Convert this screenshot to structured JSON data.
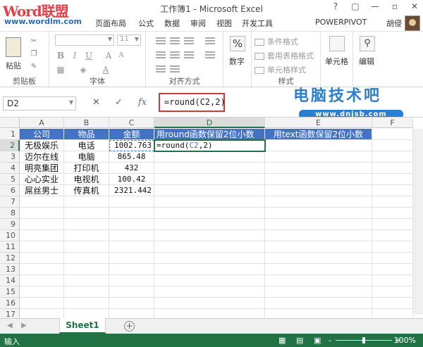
{
  "window": {
    "title": "工作簿1 - Microsoft Excel",
    "watermark_logo": "Word联盟",
    "watermark_url": "www.wordlm.com",
    "buttons": [
      "?",
      "▢",
      "—",
      "▫",
      "✕"
    ]
  },
  "ribbon_tabs": [
    "页面布局",
    "公式",
    "数据",
    "审阅",
    "视图",
    "开发工具",
    "POWERPIVOT"
  ],
  "user": "胡侵",
  "ribbon": {
    "clipboard": {
      "paste_label": "粘贴",
      "group_label": "剪贴板"
    },
    "font": {
      "font_name": "",
      "font_size": "11",
      "group_label": "字体"
    },
    "alignment": {
      "group_label": "对齐方式"
    },
    "number": {
      "icon": "%",
      "label": "数字"
    },
    "styles": {
      "items": [
        "条件格式",
        "套用表格格式",
        "单元格样式"
      ],
      "group_label": "样式"
    },
    "cells": {
      "label": "单元格"
    },
    "editing": {
      "label": "编辑"
    }
  },
  "formula_bar": {
    "name_box": "D2",
    "cancel_icon": "✕",
    "enter_icon": "✓",
    "fx_icon": "fx",
    "formula": "=round(C2,2)"
  },
  "brand": {
    "text": "电脑技术吧",
    "url": "www.dnjsb.com"
  },
  "grid": {
    "columns": [
      "A",
      "B",
      "C",
      "D",
      "E",
      "F"
    ],
    "rows": [
      "1",
      "2",
      "3",
      "4",
      "5",
      "6",
      "7",
      "8",
      "9",
      "10",
      "11",
      "12",
      "13",
      "14",
      "15",
      "16",
      "17"
    ],
    "header_row": [
      "公司",
      "物品",
      "金额",
      "用round函数保留2位小数",
      "用text函数保留2位小数"
    ],
    "data": [
      [
        "无极娱乐",
        "电话",
        "1002.763",
        "=round(C2,2)"
      ],
      [
        "迈尔在线",
        "电脑",
        "865.48",
        ""
      ],
      [
        "明亮集团",
        "打印机",
        "432",
        ""
      ],
      [
        "心心实业",
        "电视机",
        "100.42",
        ""
      ],
      [
        "屌丝男士",
        "传真机",
        "2321.442",
        ""
      ]
    ],
    "editing_formula_parts": [
      "=round(",
      "C2",
      ",2)"
    ]
  },
  "sheets": {
    "tabs": [
      "Sheet1"
    ],
    "add_icon": "+"
  },
  "status": {
    "mode": "输入",
    "zoom": "100%",
    "zoom_minus": "-",
    "zoom_plus": "+"
  },
  "colors": {
    "header_fill": "#4472c4",
    "accent": "#217346",
    "formula_highlight": "#d23a3a"
  }
}
